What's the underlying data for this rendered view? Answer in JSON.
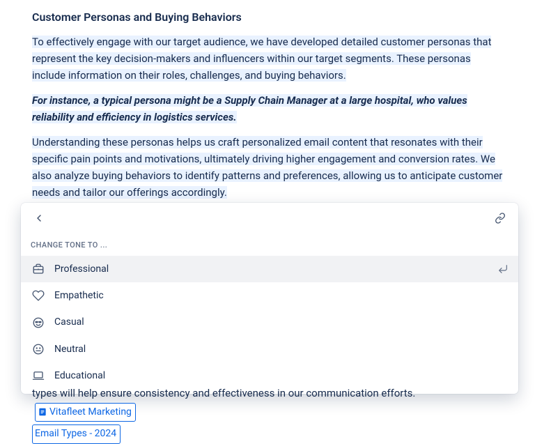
{
  "heading": "Customer Personas and Buying Behaviors",
  "p1": "To effectively engage with our target audience, we have developed detailed customer personas that represent the key decision-makers and influencers within our target segments. These personas include information on their roles, challenges, and buying behaviors.",
  "p2": "For instance, a typical persona might be a Supply Chain Manager at a large hospital, who values reliability and efficiency in logistics services.",
  "p3": "Understanding these personas helps us craft personalized email content that resonates with their specific pain points and motivations, ultimately driving higher engagement and conversion rates. We also analyze buying behaviors to identify patterns and preferences, allowing us to anticipate customer needs and tail",
  "p3b": "or",
  "p3c": "our offerings accordingly.",
  "popover": {
    "section": "CHANGE TONE TO ...",
    "items": [
      {
        "label": "Professional"
      },
      {
        "label": "Empathetic"
      },
      {
        "label": "Casual"
      },
      {
        "label": "Neutral"
      },
      {
        "label": "Educational"
      }
    ]
  },
  "trailing": {
    "text_a": "types will help ensure consistency and effectiveness in our communication efforts.",
    "chip1": "Vitafleet Marketing",
    "chip2": "Email Types - 2024"
  }
}
